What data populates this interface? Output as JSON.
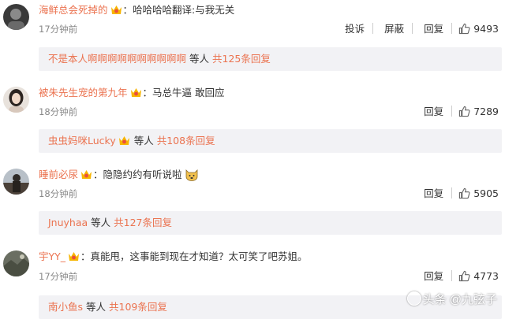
{
  "comments": [
    {
      "username": "海鲜总会死掉的",
      "text": "：哈哈哈哈翻译:与我无关",
      "time": "17分钟前",
      "actions": [
        "投诉",
        "屏蔽",
        "回复"
      ],
      "likes": "9493",
      "reply_user": "不是本人啊啊啊啊啊啊啊啊啊啊",
      "reply_suffix": "等人",
      "reply_count": "共125条回复"
    },
    {
      "username": "被朱先生宠的第九年",
      "text": "：马总牛逼 敢回应",
      "time": "18分钟前",
      "actions": [
        "回复"
      ],
      "likes": "7289",
      "reply_user": "虫虫妈咪Lucky",
      "reply_suffix": "等人",
      "reply_count": "共108条回复"
    },
    {
      "username": "睡前必尿",
      "text": "：隐隐约约有听说啦",
      "time": "18分钟前",
      "actions": [
        "回复"
      ],
      "likes": "5905",
      "reply_user": "Jnuyhaa",
      "reply_suffix": "等人",
      "reply_count": "共127条回复"
    },
    {
      "username": "宇YY_",
      "text": "：真能甩，这事能到现在才知道？太可笑了吧苏姐。",
      "time": "17分钟前",
      "actions": [
        "回复"
      ],
      "likes": "4773",
      "reply_user": "南小鱼s",
      "reply_suffix": "等人",
      "reply_count": "共109条回复"
    }
  ],
  "watermark": "头条 @九弦子",
  "colors": {
    "link": "#eb7350",
    "text": "#333333",
    "time": "#888888",
    "reply_bg": "#f2f2f5"
  },
  "icons": {
    "badge": "vip-badge-icon",
    "like": "thumbs-up-icon",
    "emoji": "dog-face-emoji-icon"
  }
}
